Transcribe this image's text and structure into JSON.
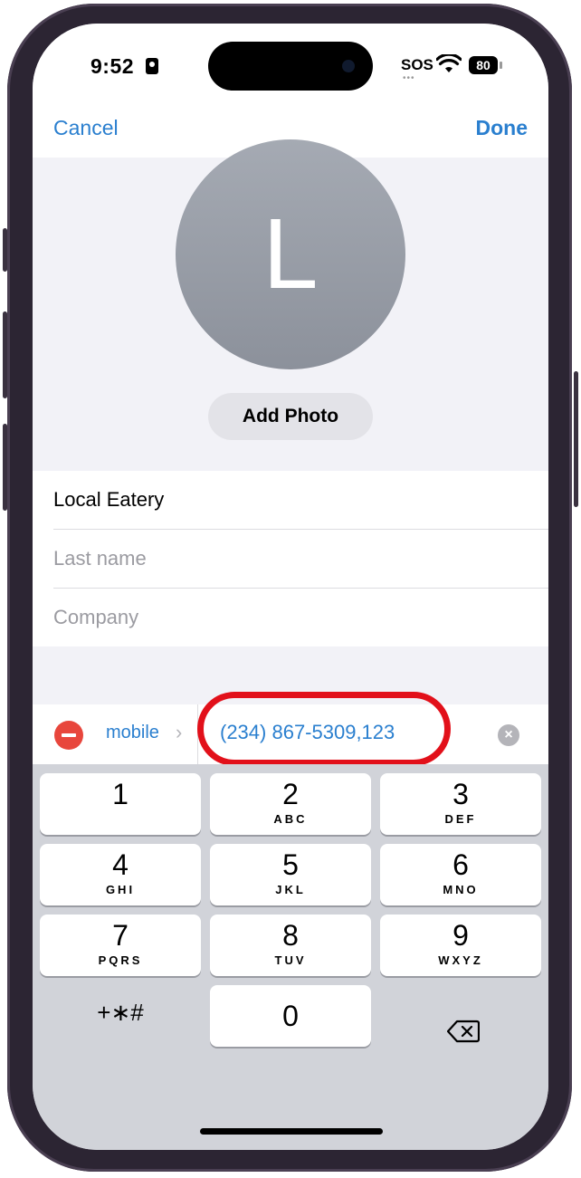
{
  "status_bar": {
    "time": "9:52",
    "sos": "SOS",
    "signal_dots": "•••",
    "battery": "80",
    "wifi_icon": "wifi-icon"
  },
  "nav": {
    "cancel": "Cancel",
    "done": "Done"
  },
  "contact": {
    "avatar_letter": "L",
    "add_photo": "Add Photo",
    "first_name": "Local Eatery",
    "last_name_placeholder": "Last name",
    "company_placeholder": "Company"
  },
  "phone_entry": {
    "label": "mobile",
    "value": "(234) 867-5309,123"
  },
  "keypad": {
    "keys": [
      {
        "num": "1",
        "letters": ""
      },
      {
        "num": "2",
        "letters": "ABC"
      },
      {
        "num": "3",
        "letters": "DEF"
      },
      {
        "num": "4",
        "letters": "GHI"
      },
      {
        "num": "5",
        "letters": "JKL"
      },
      {
        "num": "6",
        "letters": "MNO"
      },
      {
        "num": "7",
        "letters": "PQRS"
      },
      {
        "num": "8",
        "letters": "TUV"
      },
      {
        "num": "9",
        "letters": "WXYZ"
      },
      {
        "num": "0",
        "letters": ""
      }
    ],
    "symbols": "+∗#"
  },
  "colors": {
    "accent": "#2a7fcf",
    "highlight_ring": "#e2101a",
    "delete_red": "#e8463c"
  }
}
